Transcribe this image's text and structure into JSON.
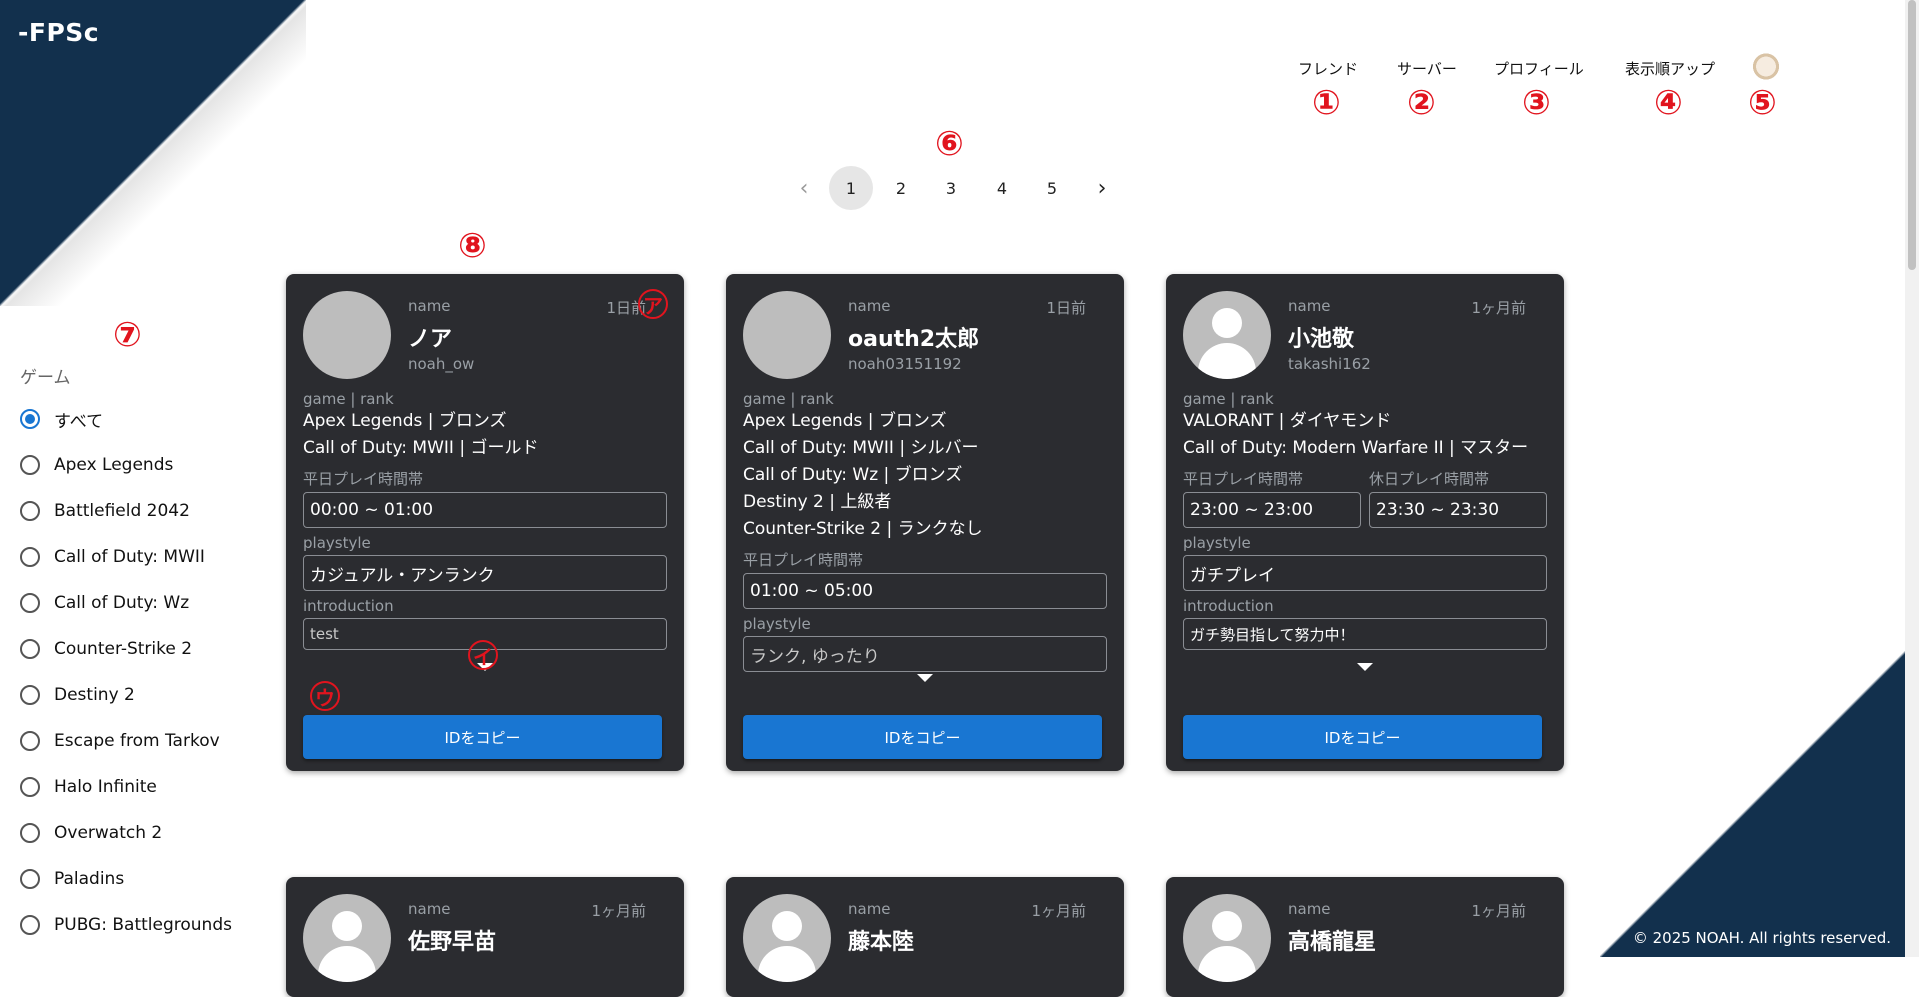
{
  "app": {
    "brand": "-FPSc"
  },
  "nav": {
    "items": [
      {
        "label": "フレンド",
        "marker": "①"
      },
      {
        "label": "サーバー",
        "marker": "②"
      },
      {
        "label": "プロフィール",
        "marker": "③"
      },
      {
        "label": "表示順アップ",
        "marker": "④"
      }
    ],
    "avatar_marker": "⑤"
  },
  "annotations": {
    "pagination": "⑥",
    "sidebar": "⑦",
    "card": "⑧",
    "a": "ア",
    "i": "イ",
    "u": "ウ"
  },
  "pagination": {
    "pages": [
      "1",
      "2",
      "3",
      "4",
      "5"
    ],
    "current": "1",
    "prev": "‹",
    "next": "›"
  },
  "sidebar": {
    "title": "ゲーム",
    "options": [
      "すべて",
      "Apex Legends",
      "Battlefield 2042",
      "Call of Duty: MWII",
      "Call of Duty: Wz",
      "Counter-Strike 2",
      "Destiny 2",
      "Escape from Tarkov",
      "Halo Infinite",
      "Overwatch 2",
      "Paladins",
      "PUBG: Battlegrounds"
    ],
    "selected": "すべて"
  },
  "labels": {
    "name": "name",
    "game_rank": "game | rank",
    "weekday": "平日プレイ時間帯",
    "holiday": "休日プレイ時間帯",
    "playstyle": "playstyle",
    "introduction": "introduction",
    "copy": "IDをコピー"
  },
  "cards": [
    {
      "name": "ノア",
      "user_id": "noah_ow",
      "time": "1日前",
      "games": [
        "Apex Legends | ブロンズ",
        "Call of Duty: MWII | ゴールド"
      ],
      "weekday": "00:00 ~ 01:00",
      "playstyle": "カジュアル・アンランク",
      "introduction": "test"
    },
    {
      "name": "oauth2太郎",
      "user_id": "noah03151192",
      "time": "1日前",
      "games": [
        "Apex Legends | ブロンズ",
        "Call of Duty: MWII | シルバー",
        "Call of Duty: Wz | ブロンズ",
        "Destiny 2 | 上級者",
        "Counter-Strike 2 | ランクなし"
      ],
      "weekday": "01:00 ~ 05:00",
      "playstyle": "ランク, ゆったり"
    },
    {
      "name": "小池敬",
      "user_id": "takashi162",
      "time": "1ヶ月前",
      "games": [
        "VALORANT | ダイヤモンド",
        "Call of Duty: Modern Warfare II | マスター"
      ],
      "weekday": "23:00 ~ 23:00",
      "holiday": "23:30 ~ 23:30",
      "playstyle": "ガチプレイ",
      "introduction": "ガチ勢目指して努力中！"
    },
    {
      "name": "佐野早苗",
      "time": "1ヶ月前"
    },
    {
      "name": "藤本陸",
      "time": "1ヶ月前"
    },
    {
      "name": "高橋龍星",
      "time": "1ヶ月前"
    }
  ],
  "footer": {
    "text": "© 2025 NOAH. All rights reserved."
  }
}
